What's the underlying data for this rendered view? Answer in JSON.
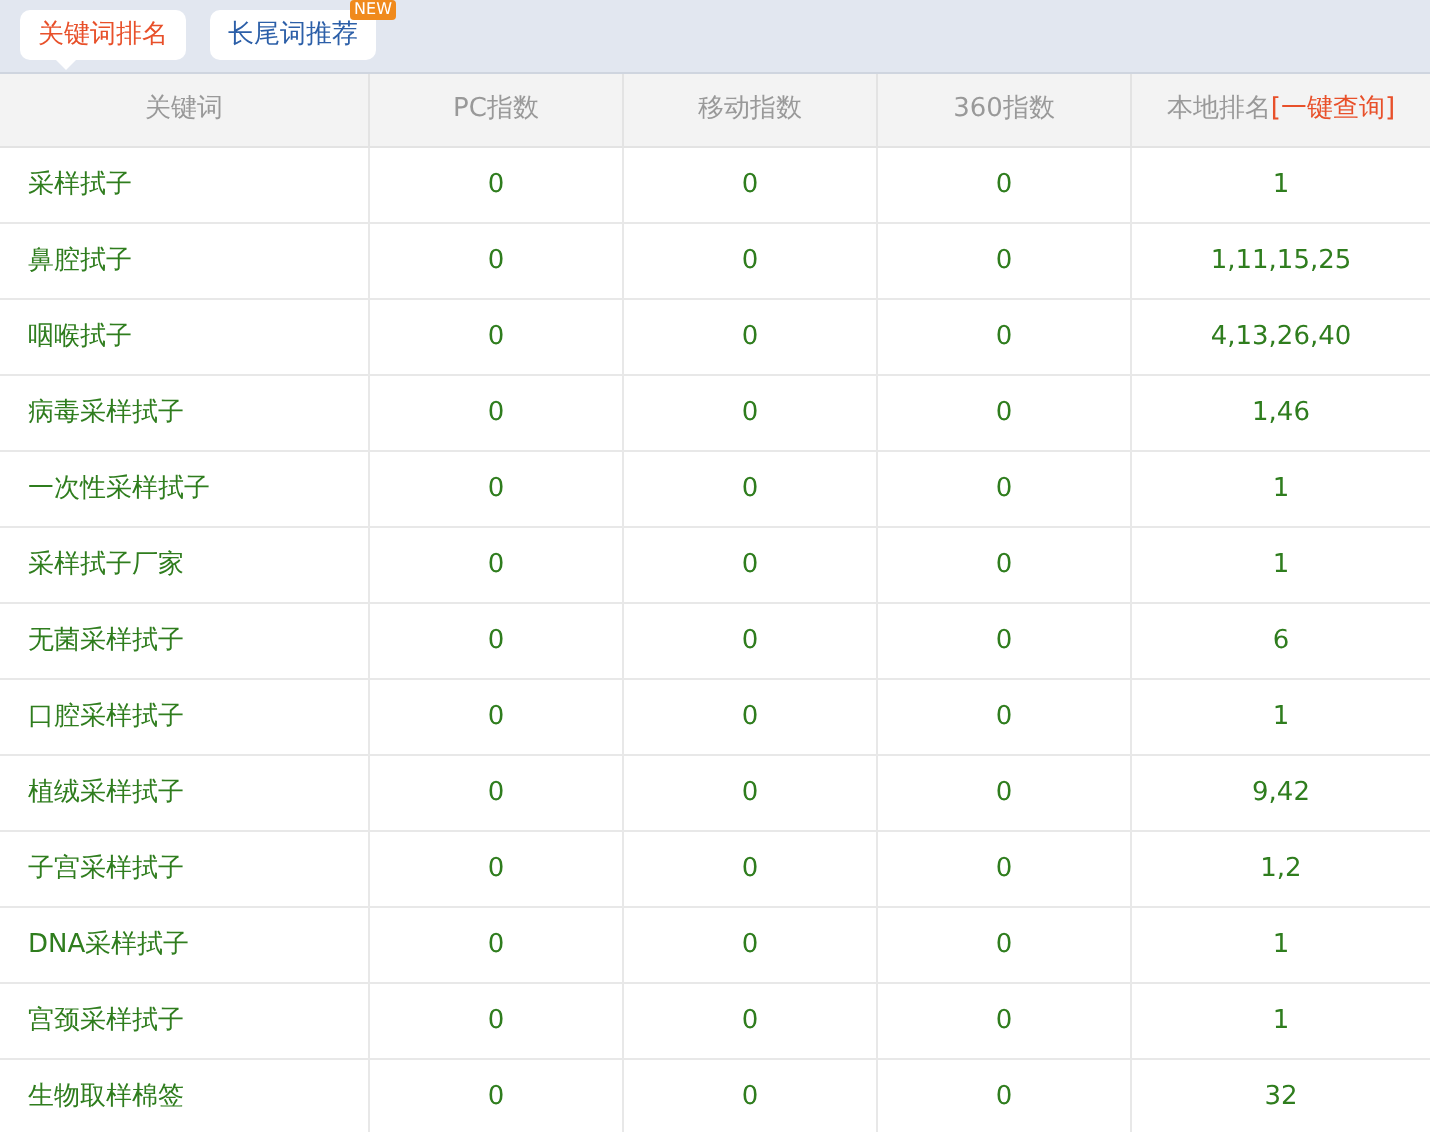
{
  "tabs": [
    {
      "label": "关键词排名",
      "selected": true
    },
    {
      "label": "长尾词推荐",
      "selected": false,
      "badge": "NEW"
    }
  ],
  "table": {
    "columns": [
      "关键词",
      "PC指数",
      "移动指数",
      "360指数"
    ],
    "last_column": {
      "label": "本地排名",
      "link": "[一键查询]"
    },
    "rows": [
      [
        "采样拭子",
        "0",
        "0",
        "0",
        "1"
      ],
      [
        "鼻腔拭子",
        "0",
        "0",
        "0",
        "1,11,15,25"
      ],
      [
        "咽喉拭子",
        "0",
        "0",
        "0",
        "4,13,26,40"
      ],
      [
        "病毒采样拭子",
        "0",
        "0",
        "0",
        "1,46"
      ],
      [
        "一次性采样拭子",
        "0",
        "0",
        "0",
        "1"
      ],
      [
        "采样拭子厂家",
        "0",
        "0",
        "0",
        "1"
      ],
      [
        "无菌采样拭子",
        "0",
        "0",
        "0",
        "6"
      ],
      [
        "口腔采样拭子",
        "0",
        "0",
        "0",
        "1"
      ],
      [
        "植绒采样拭子",
        "0",
        "0",
        "0",
        "9,42"
      ],
      [
        "子宫采样拭子",
        "0",
        "0",
        "0",
        "1,2"
      ],
      [
        "DNA采样拭子",
        "0",
        "0",
        "0",
        "1"
      ],
      [
        "宫颈采样拭子",
        "0",
        "0",
        "0",
        "1"
      ],
      [
        "生物取样棉签",
        "0",
        "0",
        "0",
        "32"
      ]
    ]
  }
}
